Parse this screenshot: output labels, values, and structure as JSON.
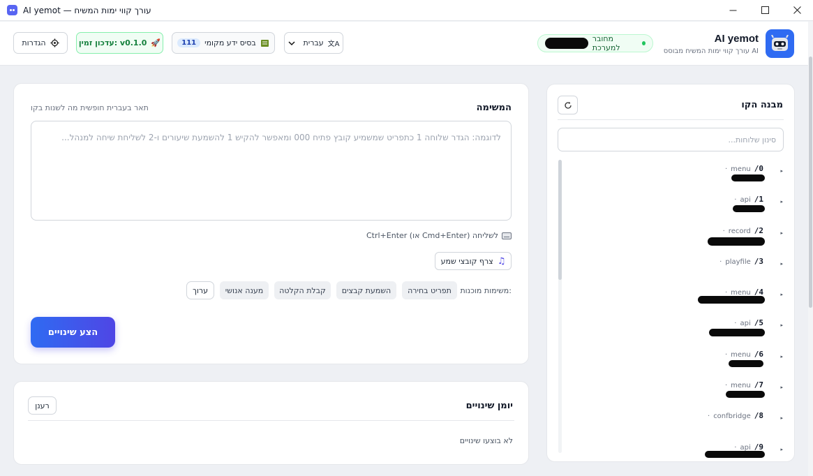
{
  "window": {
    "title": "AI yemot — עורך קווי ימות המשיח"
  },
  "brand": {
    "name": "AI yemot",
    "subtitle": "עורך קווי ימות המשיח מבוסס AI"
  },
  "connection": {
    "label": "מחובר למערכת",
    "status_color": "#22c55e"
  },
  "header": {
    "language": {
      "label": "עברית",
      "icon": "translate-icon"
    },
    "knowledge_base": {
      "label": "בסיס ידע מקומי",
      "count": "111",
      "icon": "book-icon"
    },
    "update": {
      "label": "עדכון זמין: v0.1.0",
      "icon": "rocket-icon"
    },
    "settings": {
      "label": "הגדרות",
      "icon": "gear-icon"
    }
  },
  "structure": {
    "title": "מבנה הקו",
    "filter_placeholder": "סינון שלוחות...",
    "items": [
      {
        "num": "/0",
        "type": "menu"
      },
      {
        "num": "/1",
        "type": "api"
      },
      {
        "num": "/2",
        "type": "record"
      },
      {
        "num": "/3",
        "type": "playfile"
      },
      {
        "num": "/4",
        "type": "menu"
      },
      {
        "num": "/5",
        "type": "api"
      },
      {
        "num": "/6",
        "type": "menu"
      },
      {
        "num": "/7",
        "type": "menu"
      },
      {
        "num": "/8",
        "type": "confbridge"
      },
      {
        "num": "/9",
        "type": "api"
      }
    ]
  },
  "task": {
    "title": "המשימה",
    "hint": "תאר בעברית חופשית מה לשנות בקו",
    "placeholder": "לדוגמה: הגדר שלוחה 1 כתפריט שמשמיע קובץ פתיח 000 ומאפשר להקיש 1 להשמעת שיעורים ו-2 לשליחת שיחה למנהל...",
    "shortcut": "Ctrl+Enter (או Cmd+Enter) לשליחה",
    "attach_label": "צרף קובצי שמע",
    "quick_label": "משימות מוכנות:",
    "chips": [
      "תפריט בחירה",
      "השמעת קבצים",
      "קבלת הקלטה",
      "מענה אנושי"
    ],
    "edit_label": "ערוך",
    "submit_label": "הצע שינויים"
  },
  "log": {
    "title": "יומן שינויים",
    "refresh_label": "רענן",
    "empty": "לא בוצעו שינויים"
  }
}
